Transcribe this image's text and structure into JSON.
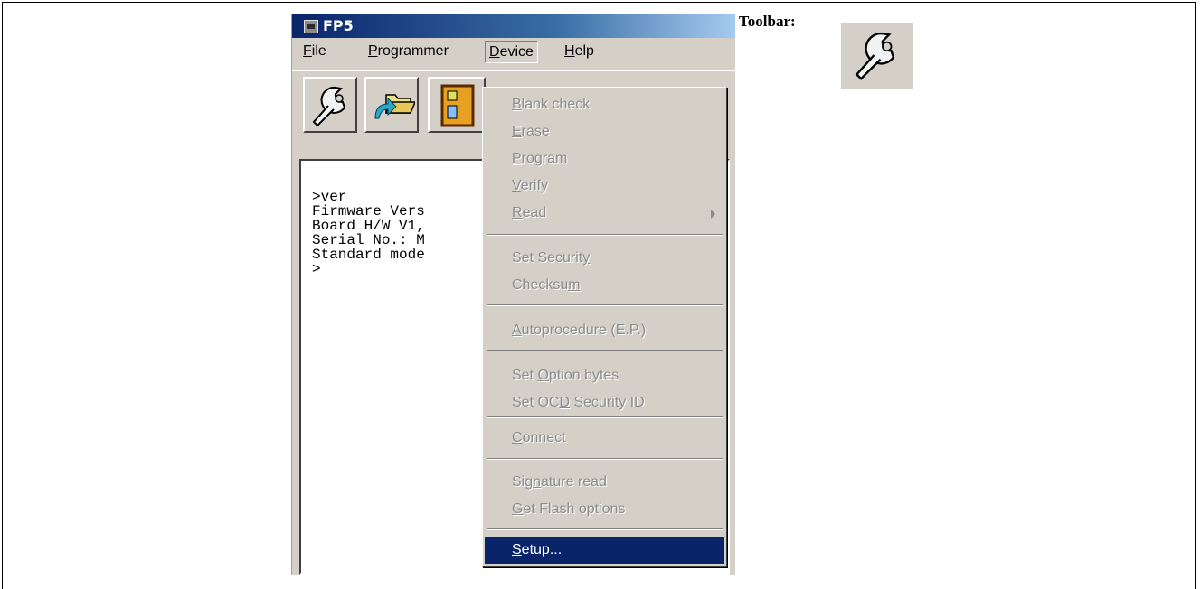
{
  "app": {
    "title": "FP5",
    "menu": {
      "file": {
        "pre": "",
        "key": "F",
        "post": "ile"
      },
      "programmer": {
        "pre": "",
        "key": "P",
        "post": "rogrammer"
      },
      "device": {
        "pre": "",
        "key": "D",
        "post": "evice"
      },
      "help": {
        "pre": "",
        "key": "H",
        "post": "elp"
      }
    },
    "toolbar_icons": [
      "wrench-icon",
      "open-folder-icon",
      "device-icon"
    ],
    "console_lines": [
      ">ver",
      "Firmware Vers",
      "Board H/W V1,",
      "Serial No.: M",
      "Standard mode",
      ">"
    ]
  },
  "device_menu": {
    "items": [
      {
        "pre": "",
        "key": "B",
        "post": "lank check"
      },
      {
        "pre": "",
        "key": "E",
        "post": "rase"
      },
      {
        "pre": "",
        "key": "P",
        "post": "rogram"
      },
      {
        "pre": "",
        "key": "V",
        "post": "erify"
      },
      {
        "pre": "",
        "key": "R",
        "post": "ead"
      },
      {
        "pre": "Set Securit",
        "key": "y",
        "post": ""
      },
      {
        "pre": "Checksu",
        "key": "m",
        "post": ""
      },
      {
        "pre": "",
        "key": "A",
        "post": "utoprocedure (E.P.)"
      },
      {
        "pre": "Set ",
        "key": "O",
        "post": "ption bytes"
      },
      {
        "pre": "Set OC",
        "key": "D",
        "post": " Security ID"
      },
      {
        "pre": "",
        "key": "C",
        "post": "onnect"
      },
      {
        "pre": "Sig",
        "key": "n",
        "post": "ature read"
      },
      {
        "pre": "",
        "key": "G",
        "post": "et Flash options"
      },
      {
        "pre": "",
        "key": "S",
        "post": "etup..."
      }
    ]
  },
  "annotation": {
    "label": "Toolbar:",
    "icon": "wrench-icon"
  },
  "colors": {
    "title_bar": "#0a246a",
    "menu_bg": "#d4d0c8",
    "highlight": "#0a246a",
    "disabled_text": "#8c8c8c"
  }
}
